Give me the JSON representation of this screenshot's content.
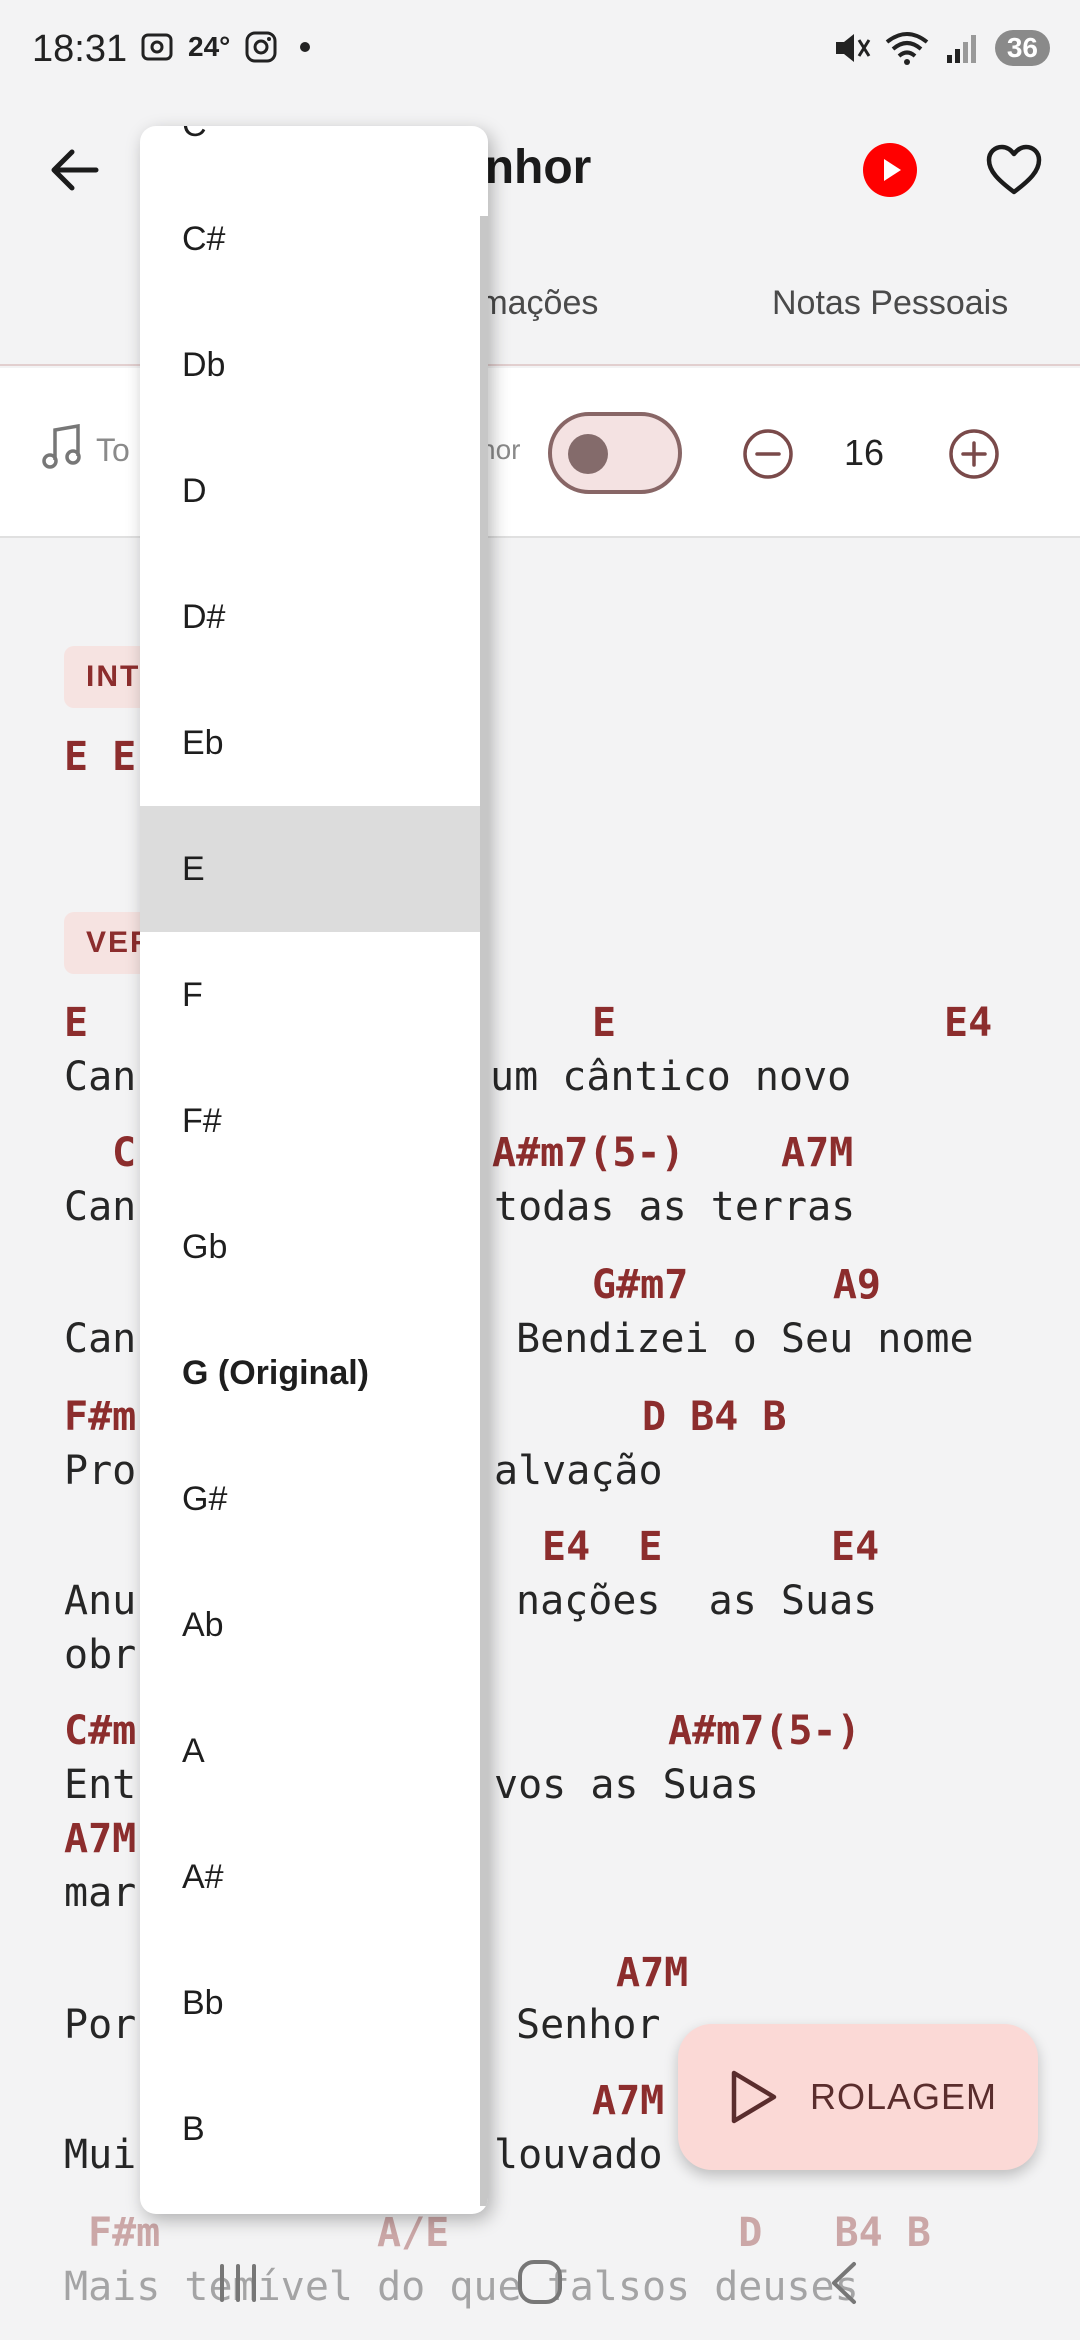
{
  "status_bar": {
    "time": "18:31",
    "temperature": "24°",
    "battery": "36",
    "icons": [
      "screenshot-icon",
      "instagram-icon",
      "mute-icon",
      "wifi-icon",
      "signal-icon"
    ]
  },
  "header": {
    "title_visible": "enhor",
    "icons": [
      "back-arrow-icon",
      "youtube-icon",
      "heart-icon"
    ],
    "colors": {
      "youtube": "#ff0000"
    }
  },
  "tabs": [
    {
      "label": "rmações"
    },
    {
      "label": "Notas Pessoais"
    }
  ],
  "toolbar": {
    "tone_label": "To",
    "minor_label": "nor",
    "font_size": "16"
  },
  "sheet": {
    "badges": [
      "INT",
      "VER"
    ],
    "lines": [
      {
        "kind": "chord",
        "text": "E E"
      },
      {
        "kind": "chord",
        "text": "E"
      },
      {
        "kind": "chord",
        "text": "E"
      },
      {
        "kind": "chord",
        "text": "E4"
      },
      {
        "kind": "lyric",
        "text": "Can"
      },
      {
        "kind": "lyric",
        "text": "um cântico novo"
      },
      {
        "kind": "chord",
        "text": "C"
      },
      {
        "kind": "chord",
        "text": "A#m7(5-)    A7M"
      },
      {
        "kind": "lyric",
        "text": "Can"
      },
      {
        "kind": "lyric",
        "text": "todas as terras"
      },
      {
        "kind": "chord",
        "text": "G#m7      A9"
      },
      {
        "kind": "lyric",
        "text": "Can"
      },
      {
        "kind": "lyric",
        "text": "Bendizei o Seu nome"
      },
      {
        "kind": "chord",
        "text": "F#m"
      },
      {
        "kind": "chord",
        "text": "D B4 B"
      },
      {
        "kind": "lyric",
        "text": "Pro"
      },
      {
        "kind": "lyric",
        "text": "alvação"
      },
      {
        "kind": "chord",
        "text": "E4  E       E4"
      },
      {
        "kind": "lyric",
        "text": "Anu"
      },
      {
        "kind": "lyric",
        "text": "nações  as Suas"
      },
      {
        "kind": "lyric",
        "text": "obr"
      },
      {
        "kind": "chord",
        "text": "C#m"
      },
      {
        "kind": "chord",
        "text": "A#m7(5-)"
      },
      {
        "kind": "lyric",
        "text": "Ent"
      },
      {
        "kind": "lyric",
        "text": "vos as Suas"
      },
      {
        "kind": "chord",
        "text": "A7M"
      },
      {
        "kind": "lyric",
        "text": "mar"
      },
      {
        "kind": "chord",
        "text": "A7M"
      },
      {
        "kind": "lyric",
        "text": "Por"
      },
      {
        "kind": "lyric",
        "text": "Senhor"
      },
      {
        "kind": "chord",
        "text": "A7M"
      },
      {
        "kind": "lyric",
        "text": "Mui"
      },
      {
        "kind": "lyric",
        "text": "louvado"
      },
      {
        "kind": "chord",
        "text": "F#m         A/E            D   B4 B"
      },
      {
        "kind": "lyric",
        "text": "Mais temível do que falsos deuses"
      }
    ]
  },
  "key_dropdown": {
    "partial_top": "C",
    "options": [
      {
        "label": "C#"
      },
      {
        "label": "Db"
      },
      {
        "label": "D"
      },
      {
        "label": "D#"
      },
      {
        "label": "Eb"
      },
      {
        "label": "E",
        "selected": true
      },
      {
        "label": "F"
      },
      {
        "label": "F#"
      },
      {
        "label": "Gb"
      },
      {
        "label": "G (Original)",
        "original": true
      },
      {
        "label": "G#"
      },
      {
        "label": "Ab"
      },
      {
        "label": "A"
      },
      {
        "label": "A#"
      },
      {
        "label": "Bb"
      },
      {
        "label": "B"
      }
    ]
  },
  "fab": {
    "label": "ROLAGEM",
    "icon": "play-outline-icon"
  },
  "nav_bar": {
    "icons": [
      "recent-apps-icon",
      "home-icon",
      "back-icon"
    ]
  },
  "colors": {
    "chord": "#8c2d2d",
    "badge_bg": "#f6e3e1",
    "fab_bg": "#fbd9d6",
    "selected_option_bg": "#dcdcdc"
  }
}
